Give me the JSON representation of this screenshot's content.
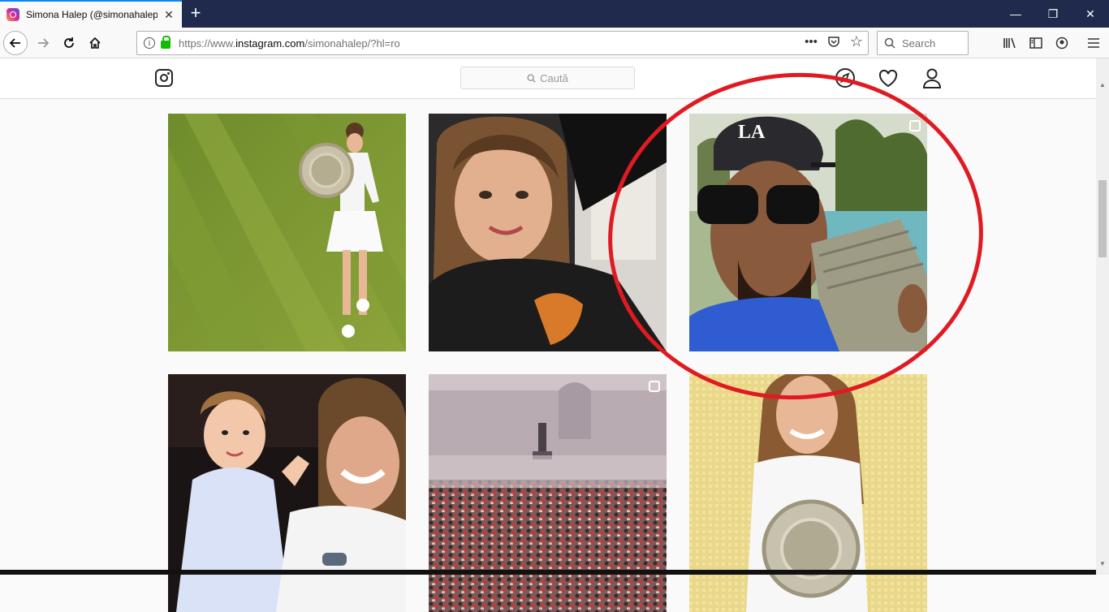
{
  "browser": {
    "tab_title": "Simona Halep (@simonahalep)",
    "tab_close": "✕",
    "new_tab": "+",
    "window_controls": {
      "minimize": "—",
      "maximize": "❐",
      "close": "✕"
    },
    "url_prefix": "https://www.",
    "url_domain": "instagram.com",
    "url_path": "/simonahalep/?hl=ro",
    "url_actions": {
      "more": "•••",
      "pocket": "⛉",
      "bookmark": "☆"
    },
    "search_placeholder": "Search"
  },
  "instagram": {
    "search_placeholder": "Caută",
    "search_icon": "magnifier-icon",
    "nav_icons": [
      "compass-icon",
      "heart-icon",
      "profile-icon"
    ]
  },
  "posts": [
    {
      "name": "post-tennis-trophy-grass",
      "badge": false
    },
    {
      "name": "post-selfie-car",
      "badge": false
    },
    {
      "name": "post-man-sunglasses-money",
      "badge": true
    },
    {
      "name": "post-child-on-shoulder",
      "badge": false
    },
    {
      "name": "post-crowd-square",
      "badge": true
    },
    {
      "name": "post-trophy-yellow",
      "badge": false
    }
  ],
  "annotation": {
    "color": "#e01a22"
  }
}
